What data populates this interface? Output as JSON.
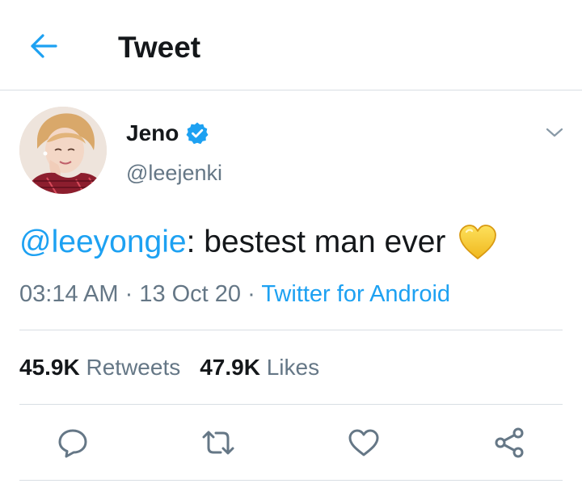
{
  "header": {
    "title": "Tweet",
    "back_icon": "arrow-left-icon"
  },
  "author": {
    "name": "Jeno",
    "handle": "@leejenki",
    "verified": true
  },
  "tweet": {
    "mention": "@leeyongie",
    "text": ": bestest man ever",
    "emoji": "yellow-heart"
  },
  "meta": {
    "time": "03:14 AM",
    "separator": " · ",
    "date": "13 Oct 20",
    "source": "Twitter for Android"
  },
  "stats": {
    "retweets_count": "45.9K",
    "retweets_label": "Retweets",
    "likes_count": "47.9K",
    "likes_label": "Likes"
  },
  "actions": [
    "reply-icon",
    "retweet-icon",
    "like-icon",
    "share-icon"
  ],
  "colors": {
    "accent": "#1da1f2",
    "text": "#14171a",
    "secondary": "#657786",
    "divider": "#d8dee3"
  }
}
